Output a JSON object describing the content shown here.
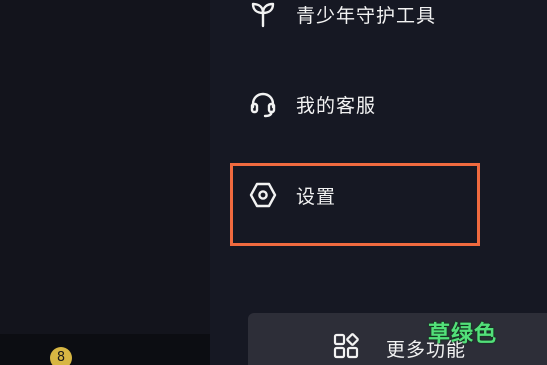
{
  "menu": {
    "items": [
      {
        "label": "青少年守护工具",
        "icon": "sprout-icon"
      },
      {
        "label": "我的客服",
        "icon": "headset-icon"
      },
      {
        "label": "设置",
        "icon": "hexagon-settings-icon"
      }
    ]
  },
  "more_bar": {
    "label": "更多功能",
    "icon": "apps-grid-icon"
  },
  "left_panel": {
    "badge_count": "8"
  },
  "watermark": "草绿色",
  "colors": {
    "background": "#161823",
    "highlight": "#f06a3f",
    "badge": "#d7b643",
    "watermark": "#53e07a"
  }
}
